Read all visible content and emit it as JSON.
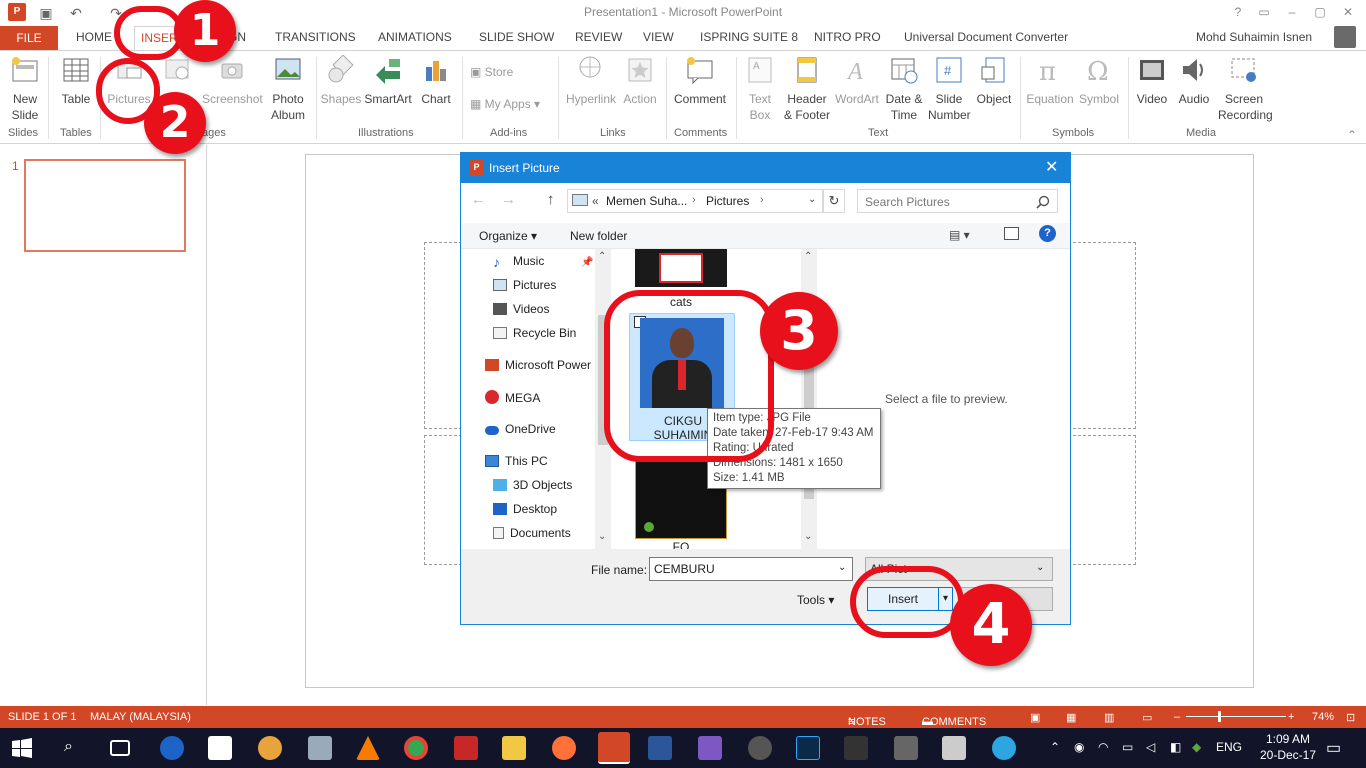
{
  "app": {
    "window_title": "Presentation1 - Microsoft PowerPoint",
    "user_name": "Mohd Suhaimin Isnen",
    "accent_color": "#d24726"
  },
  "tabs": [
    "FILE",
    "HOME",
    "INSERT",
    "DESIGN",
    "TRANSITIONS",
    "ANIMATIONS",
    "SLIDE SHOW",
    "REVIEW",
    "VIEW",
    "ISPRING SUITE 8",
    "NITRO PRO",
    "Universal Document Converter"
  ],
  "ribbon": {
    "new_slide": [
      "New",
      "Slide"
    ],
    "table": "Table",
    "pictures": "Pictures",
    "screenshot": "Screenshot",
    "photo_album": [
      "Photo",
      "Album"
    ],
    "shapes": "Shapes",
    "smartart": "SmartArt",
    "chart": "Chart",
    "store": "Store",
    "my_apps": "My Apps",
    "hyperlink": "Hyperlink",
    "action": "Action",
    "comment": "Comment",
    "text_box": [
      "Text",
      "Box"
    ],
    "header_footer": [
      "Header",
      "& Footer"
    ],
    "wordart": "WordArt",
    "date_time": [
      "Date &",
      "Time"
    ],
    "slide_number": [
      "Slide",
      "Number"
    ],
    "object": "Object",
    "equation": "Equation",
    "symbol": "Symbol",
    "video": "Video",
    "audio": "Audio",
    "screen_recording": [
      "Screen",
      "Recording"
    ],
    "groups": {
      "slides": "Slides",
      "tables": "Tables",
      "images": "ages",
      "illustrations": "Illustrations",
      "addins": "Add-ins",
      "links": "Links",
      "comments": "Comments",
      "text": "Text",
      "symbols": "Symbols",
      "media": "Media"
    }
  },
  "thumbnails": {
    "slide_number": "1"
  },
  "dialog": {
    "title": "Insert Picture",
    "breadcrumb": [
      "«",
      "Memen Suha...",
      "Pictures"
    ],
    "search_placeholder": "Search Pictures",
    "organize": "Organize",
    "new_folder": "New folder",
    "nav_items": [
      "Music",
      "Pictures",
      "Videos",
      "Recycle Bin",
      "Microsoft Power",
      "MEGA",
      "OneDrive",
      "This PC",
      "3D Objects",
      "Desktop",
      "Documents"
    ],
    "files": {
      "top_label": "cats",
      "selected_label_1": "CIKGU",
      "selected_label_2": "SUHAIMIN",
      "bottom_label": "FO"
    },
    "tooltip": [
      "Item type: JPG File",
      "Date taken: 27-Feb-17 9:43 AM",
      "Rating: Unrated",
      "Dimensions: 1481 x 1650",
      "Size: 1.41 MB"
    ],
    "preview_text": "Select a file to preview.",
    "file_name_label": "File name:",
    "file_name_value": "CEMBURU",
    "filter_value": "All Pict",
    "tools": "Tools",
    "insert": "Insert",
    "cancel": ""
  },
  "annotations": [
    "1",
    "2",
    "3",
    "4"
  ],
  "status": {
    "slide": "SLIDE 1 OF 1",
    "language": "MALAY (MALAYSIA)",
    "notes": "NOTES",
    "comments": "COMMENTS",
    "zoom": "74%"
  },
  "taskbar": {
    "language": "ENG",
    "time": "1:09 AM",
    "date": "20-Dec-17"
  }
}
